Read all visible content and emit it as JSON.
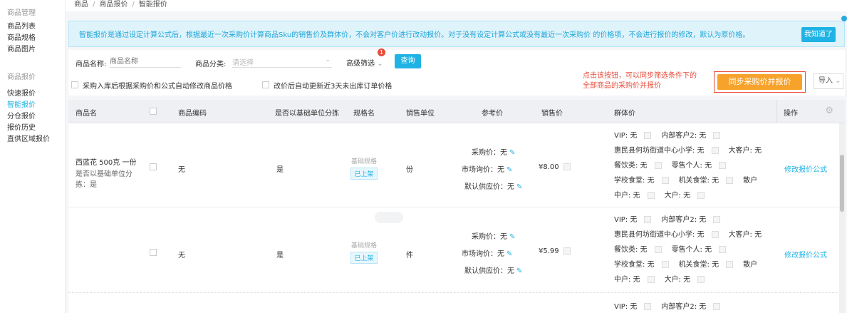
{
  "sidebar": {
    "group1": "商品管理",
    "items1": [
      "商品列表",
      "商品规格",
      "商品图片"
    ],
    "group2": "商品报价",
    "items2": [
      "快速报价",
      "智能报价",
      "分仓报价",
      "报价历史",
      "直供区域报价"
    ]
  },
  "breadcrumb": [
    "商品",
    "商品报价",
    "智能报价"
  ],
  "notice": {
    "text": "智能报价是通过设定计算公式后，根据最近一次采购价计算商品Sku的销售价及群体价，不会对客户价进行改动报价。对于没有设定计算公式或没有最近一次采购价 的价格项，不会进行报价的修改，默认为原价格。",
    "button": "我知道了"
  },
  "filter": {
    "name_label": "商品名称:",
    "name_placeholder": "商品名称",
    "category_label": "商品分类:",
    "category_placeholder": "请选择",
    "advanced": "高级筛选",
    "advanced_badge": "1",
    "query": "查询",
    "check1": "采购入库后根据采购价和公式自动修改商品价格",
    "check2": "改价后自动更新近3天未出库订单价格",
    "annotation_line1": "点击该按钮，可以同步筛选条件下的",
    "annotation_line2": "全部商品的采购价并报价",
    "sync": "同步采购价并报价",
    "import": "导入"
  },
  "table": {
    "headers": {
      "name": "商品名",
      "code": "商品编码",
      "base_unit": "是否以基础单位分拣",
      "spec": "规格名",
      "unit": "销售单位",
      "ref": "参考价",
      "price": "销售价",
      "group": "群体价",
      "op": "操作"
    },
    "rows": [
      {
        "name1": "西蓝花 500克 一份",
        "name2": "是否以基础单位分",
        "name3": "拣：是",
        "code": "无",
        "base_unit": "是",
        "spec": "基础规格",
        "spec_tag": "已上架",
        "unit": "份",
        "purchase": "采购价：无",
        "market": "市场询价：无",
        "supplier": "默认供应价：无",
        "price": "¥8.00",
        "g1a": "VIP: 无",
        "g1b": "内部客户2: 无",
        "g2a": "惠民县何坊街道中心小学: 无",
        "g2b": "大客户: 无",
        "g3a": "餐饮类: 无",
        "g3b": "零售个人: 无",
        "g4a": "学校食堂: 无",
        "g4b": "机关食堂: 无",
        "g4c": "散户",
        "g5a": "中户: 无",
        "g5b": "大户: 无",
        "op": "修改报价公式"
      },
      {
        "code": "无",
        "base_unit": "是",
        "spec": "基础规格",
        "spec_tag": "已上架",
        "unit": "件",
        "purchase": "采购价：无",
        "market": "市场询价：无",
        "supplier": "默认供应价：无",
        "price": "¥5.99",
        "g1a": "VIP: 无",
        "g1b": "内部客户2: 无",
        "g2a": "惠民县何坊街道中心小学: 无",
        "g2b": "大客户: 无",
        "g3a": "餐饮类: 无",
        "g3b": "零售个人: 无",
        "g4a": "学校食堂: 无",
        "g4b": "机关食堂: 无",
        "g4c": "散户",
        "g5a": "中户: 无",
        "g5b": "大户: 无",
        "op": "修改报价公式"
      },
      {
        "g1a": "VIP: 无",
        "g1b": "内部客户2: 无"
      }
    ]
  }
}
